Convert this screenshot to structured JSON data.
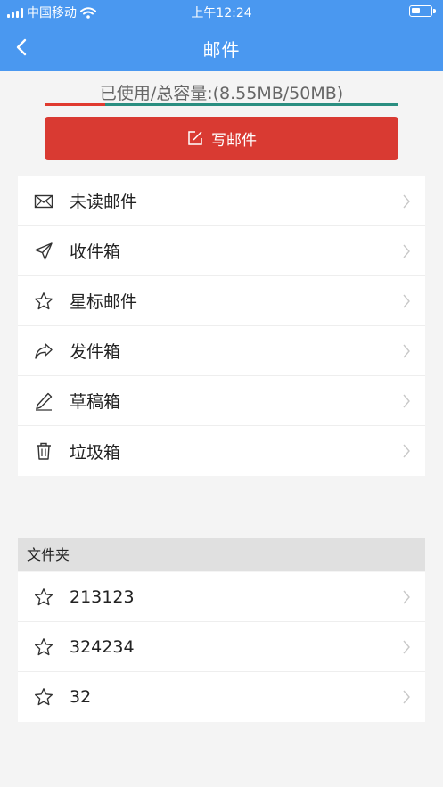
{
  "status": {
    "carrier": "中国移动",
    "time": "上午12:24"
  },
  "header": {
    "title": "邮件"
  },
  "quota": {
    "text": "已使用/总容量:(8.55MB/50MB)",
    "used_fraction": 0.171
  },
  "compose": {
    "label": "写邮件"
  },
  "mailboxes": [
    {
      "label": "未读邮件",
      "icon": "envelope-icon"
    },
    {
      "label": "收件箱",
      "icon": "paper-plane-icon"
    },
    {
      "label": "星标邮件",
      "icon": "star-icon"
    },
    {
      "label": "发件箱",
      "icon": "share-arrow-icon"
    },
    {
      "label": "草稿箱",
      "icon": "pencil-icon"
    },
    {
      "label": "垃圾箱",
      "icon": "trash-icon"
    }
  ],
  "folders": {
    "title": "文件夹",
    "items": [
      {
        "label": "213123",
        "icon": "star-icon"
      },
      {
        "label": "324234",
        "icon": "star-icon"
      },
      {
        "label": "32",
        "icon": "star-icon"
      }
    ]
  },
  "colors": {
    "header": "#4a98f0",
    "compose": "#d93a32",
    "quota_used": "#e03a2f",
    "quota_free": "#2a8e80"
  }
}
